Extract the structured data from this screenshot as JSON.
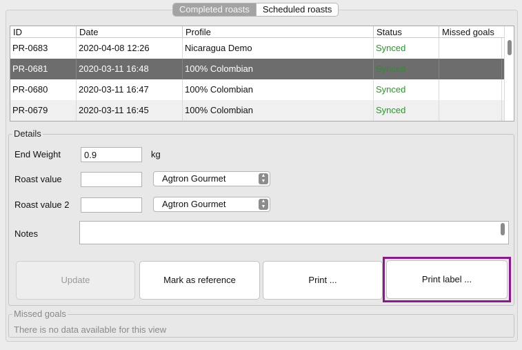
{
  "tabs": [
    {
      "label": "Completed roasts",
      "active": true
    },
    {
      "label": "Scheduled roasts",
      "active": false
    }
  ],
  "table": {
    "columns": [
      "ID",
      "Date",
      "Profile",
      "Status",
      "Missed goals"
    ],
    "rows": [
      {
        "id": "PR-0683",
        "date": "2020-04-08 12:26",
        "profile": "Nicaragua Demo",
        "status": "Synced",
        "missed_goals": ""
      },
      {
        "id": "PR-0681",
        "date": "2020-03-11 16:48",
        "profile": "100% Colombian",
        "status": "Synced",
        "missed_goals": "",
        "selected": true
      },
      {
        "id": "PR-0680",
        "date": "2020-03-11 16:47",
        "profile": "100% Colombian",
        "status": "Synced",
        "missed_goals": ""
      },
      {
        "id": "PR-0679",
        "date": "2020-03-11 16:45",
        "profile": "100% Colombian",
        "status": "Synced",
        "missed_goals": ""
      }
    ]
  },
  "details": {
    "title": "Details",
    "end_weight": {
      "label": "End Weight",
      "value": "0.9",
      "unit": "kg"
    },
    "roast_value": {
      "label": "Roast value",
      "value": "",
      "scale": "Agtron Gourmet"
    },
    "roast_value_2": {
      "label": "Roast value 2",
      "value": "",
      "scale": "Agtron Gourmet"
    },
    "notes": {
      "label": "Notes",
      "value": ""
    }
  },
  "buttons": {
    "update": "Update",
    "mark_reference": "Mark as reference",
    "print": "Print ...",
    "print_label": "Print label ..."
  },
  "missed_goals": {
    "title": "Missed goals",
    "empty_message": "There is no data available for this view"
  },
  "colors": {
    "status_synced": "#1f9e1f",
    "selected_row": "#6d6d6d",
    "highlight": "#8e1790"
  }
}
